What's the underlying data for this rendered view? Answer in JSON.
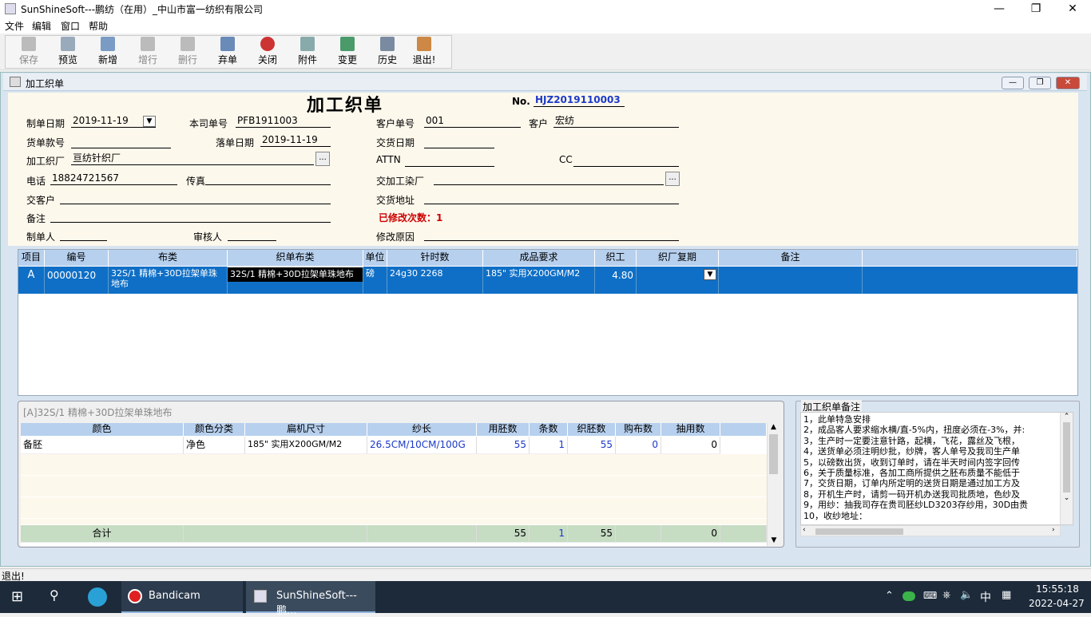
{
  "app": {
    "title": "SunShineSoft---鹏纺（在用）_中山市富一纺织有限公司"
  },
  "menu": [
    "文件",
    "编辑",
    "窗口",
    "帮助"
  ],
  "toolbar": [
    {
      "label": "保存",
      "enabled": false
    },
    {
      "label": "预览",
      "enabled": true
    },
    {
      "label": "新增",
      "enabled": true
    },
    {
      "label": "增行",
      "enabled": false
    },
    {
      "label": "删行",
      "enabled": false
    },
    {
      "label": "弃单",
      "enabled": true
    },
    {
      "label": "关闭",
      "enabled": true
    },
    {
      "label": "附件",
      "enabled": true
    },
    {
      "label": "变更",
      "enabled": true
    },
    {
      "label": "历史",
      "enabled": true
    },
    {
      "label": "退出!",
      "enabled": true
    }
  ],
  "child": {
    "title": "加工织单"
  },
  "form": {
    "heading": "加工织单",
    "no_label": "No.",
    "no_value": "HJZ2019110003",
    "make_date_label": "制单日期",
    "make_date": "2019-11-19",
    "own_no_label": "本司单号",
    "own_no": "PFB1911003",
    "cust_no_label": "客户单号",
    "cust_no": "001",
    "customer_label": "客户",
    "customer": "宏纺",
    "goods_no_label": "货单款号",
    "goods_no": "",
    "order_date_label": "落单日期",
    "order_date": "2019-11-19",
    "delivery_date_label": "交货日期",
    "delivery_date": "",
    "weave_factory_label": "加工织厂",
    "weave_factory": "亘纺针织厂",
    "attn_label": "ATTN",
    "attn": "",
    "cc_label": "CC",
    "cc": "",
    "phone_label": "电话",
    "phone": "18824721567",
    "fax_label": "传真",
    "fax": "",
    "dye_factory_label": "交加工染厂",
    "dye_factory": "",
    "deliver_cust_label": "交客户",
    "deliver_cust": "",
    "deliver_addr_label": "交货地址",
    "deliver_addr": "",
    "remark_label": "备注",
    "remark": "",
    "modified_label": "已修改次数：1",
    "maker_label": "制单人",
    "maker": "",
    "auditor_label": "审核人",
    "auditor": "",
    "reason_label": "修改原因",
    "reason": ""
  },
  "grid1": {
    "headers": [
      "项目",
      "编号",
      "布类",
      "织单布类",
      "单位",
      "针时数",
      "成品要求",
      "织工",
      "织厂复期",
      "备注"
    ],
    "row": {
      "item": "A",
      "code": "00000120",
      "fabric": "32S/1 精棉+30D拉架单珠地布",
      "order_fabric": "32S/1 精棉+30D拉架单珠地布",
      "unit": "磅",
      "needle": "24g30 2268",
      "finish": "185\" 实用X200GM/M2",
      "weave_price": "4.80",
      "recheck": "",
      "remark": ""
    }
  },
  "grid2": {
    "caption": "[A]32S/1 精棉+30D拉架单珠地布",
    "headers": [
      "颜色",
      "颜色分类",
      "扁机尺寸",
      "纱长",
      "用胚数",
      "条数",
      "织胚数",
      "购布数",
      "抽用数"
    ],
    "row": {
      "color": "备胚",
      "color_class": "净色",
      "size": "185\" 实用X200GM/M2",
      "yarn_len": "26.5CM/10CM/100G",
      "use": "55",
      "strips": "1",
      "woven": "55",
      "bought": "0",
      "drawn": "0"
    },
    "total": {
      "label": "合计",
      "use": "55",
      "strips": "1",
      "woven": "55",
      "drawn": "0"
    }
  },
  "notes": {
    "caption": "加工织单备注",
    "text": "1，此单特急安排\n2，成品客人要求缩水横/直-5%内，扭度必须在-3%，并:\n3，生产时一定要注意针路，起横，飞花，露丝及飞根，\n4，送货单必须注明纱批，纱牌，客人单号及我司生产单\n5，以磅数出货，收到订单时，请在半天时间内签字回传\n6，关于质量标准，各加工商所提供之胚布质量不能低于\n7，交货日期，订单内所定明的送货日期是通过加工方及\n8，开机生产时，请剪一码开机办送我司批质地，色纱及\n9，用纱：抽我司存在贵司胚纱LD3203存纱用，30D由贵\n10，收纱地址："
  },
  "status": {
    "text": "退出!"
  },
  "taskbar": {
    "app1": "Bandicam",
    "app2": "SunShineSoft---鹏...",
    "ime": "中",
    "time": "15:55:18",
    "date": "2022-04-27"
  }
}
